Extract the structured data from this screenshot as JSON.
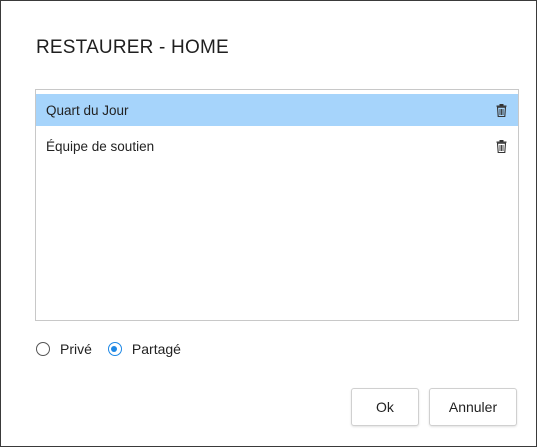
{
  "dialog": {
    "title": "RESTAURER - HOME"
  },
  "list": {
    "items": [
      {
        "label": "Quart du Jour",
        "selected": true,
        "action_icon": "trash-icon"
      },
      {
        "label": "Équipe de soutien",
        "selected": false,
        "action_icon": "trash-icon"
      }
    ]
  },
  "visibility": {
    "options": [
      {
        "label": "Privé",
        "checked": false
      },
      {
        "label": "Partagé",
        "checked": true
      }
    ]
  },
  "buttons": {
    "ok_label": "Ok",
    "cancel_label": "Annuler"
  },
  "colors": {
    "selected_row": "#a6d4fb",
    "radio_accent": "#1e88e5"
  }
}
